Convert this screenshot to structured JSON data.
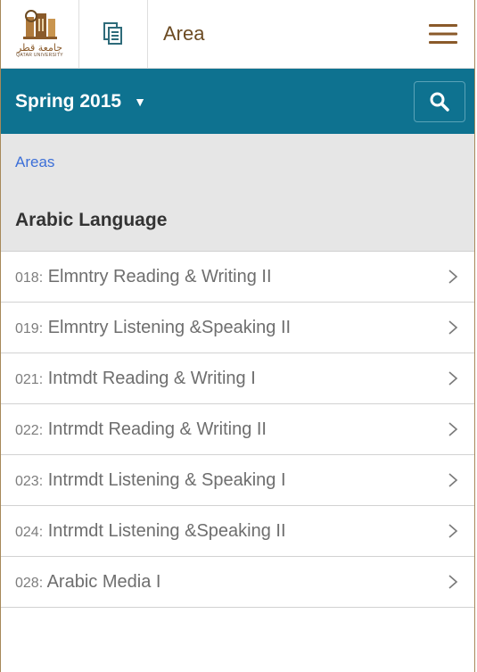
{
  "header": {
    "title": "Area",
    "logo_ar": "جامعة قطر",
    "logo_en": "QATAR UNIVERSITY",
    "logo_icon": "university-logo",
    "doc_icon": "document-copy-icon",
    "menu_icon": "hamburger-menu-icon"
  },
  "termbar": {
    "term": "Spring 2015",
    "caret": "▼",
    "search_icon": "search-icon",
    "color": "#0e7290"
  },
  "breadcrumb": {
    "link": "Areas"
  },
  "section": {
    "title": "Arabic Language"
  },
  "courses": [
    {
      "code": "018:",
      "name": " Elmntry Reading & Writing II"
    },
    {
      "code": "019:",
      "name": " Elmntry Listening &Speaking II"
    },
    {
      "code": "021:",
      "name": " Intmdt Reading & Writing I"
    },
    {
      "code": "022:",
      "name": " Intrmdt Reading & Writing II"
    },
    {
      "code": "023:",
      "name": " Intrmdt Listening & Speaking I"
    },
    {
      "code": "024:",
      "name": " Intrmdt Listening &Speaking II"
    },
    {
      "code": "028:",
      "name": " Arabic Media I"
    }
  ],
  "colors": {
    "accent": "#0e7290",
    "link": "#3c6fd8",
    "brand_brown": "#6b4a22"
  }
}
